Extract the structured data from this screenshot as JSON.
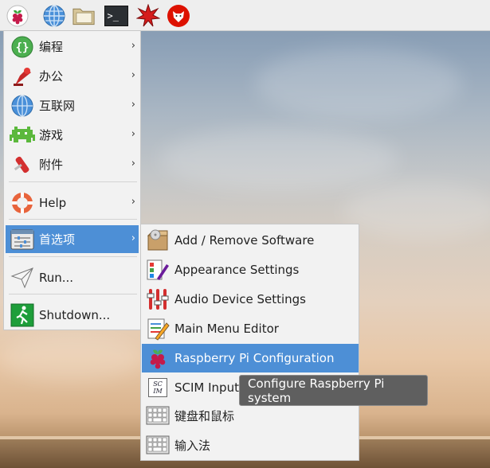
{
  "taskbar": {
    "icons": [
      "raspberry-icon",
      "web-browser-icon",
      "file-manager-icon",
      "terminal-icon",
      "mathematica-icon",
      "wolfram-icon"
    ],
    "terminal_glyph": ">_"
  },
  "menu": {
    "items": [
      {
        "label": "编程",
        "icon": "programming-icon",
        "has_submenu": true
      },
      {
        "label": "办公",
        "icon": "office-icon",
        "has_submenu": true
      },
      {
        "label": "互联网",
        "icon": "internet-icon",
        "has_submenu": true
      },
      {
        "label": "游戏",
        "icon": "games-icon",
        "has_submenu": true
      },
      {
        "label": "附件",
        "icon": "accessories-icon",
        "has_submenu": true
      },
      {
        "label": "Help",
        "icon": "help-icon",
        "has_submenu": true
      },
      {
        "label": "首选项",
        "icon": "preferences-icon",
        "has_submenu": true,
        "selected": true
      },
      {
        "label": "Run...",
        "icon": "run-icon",
        "has_submenu": false
      },
      {
        "label": "Shutdown...",
        "icon": "shutdown-icon",
        "has_submenu": false
      }
    ],
    "arrow": "›"
  },
  "submenu": {
    "items": [
      {
        "label": "Add / Remove Software",
        "icon": "package-icon"
      },
      {
        "label": "Appearance Settings",
        "icon": "appearance-icon"
      },
      {
        "label": "Audio Device Settings",
        "icon": "audio-mixer-icon"
      },
      {
        "label": "Main Menu Editor",
        "icon": "menu-editor-icon"
      },
      {
        "label": "Raspberry Pi Configuration",
        "icon": "raspberry-icon",
        "selected": true
      },
      {
        "label": "SCIM Input",
        "icon": "scim-icon"
      },
      {
        "label": "键盘和鼠标",
        "icon": "keyboard-icon"
      },
      {
        "label": "输入法",
        "icon": "keyboard-icon"
      }
    ],
    "scim_glyph": "SC IM"
  },
  "tooltip": {
    "text": "Configure Raspberry Pi system"
  },
  "colors": {
    "selection": "#4d8fd6",
    "menu_bg": "#f2f2f2",
    "tooltip_bg": "#5f5f5f"
  }
}
